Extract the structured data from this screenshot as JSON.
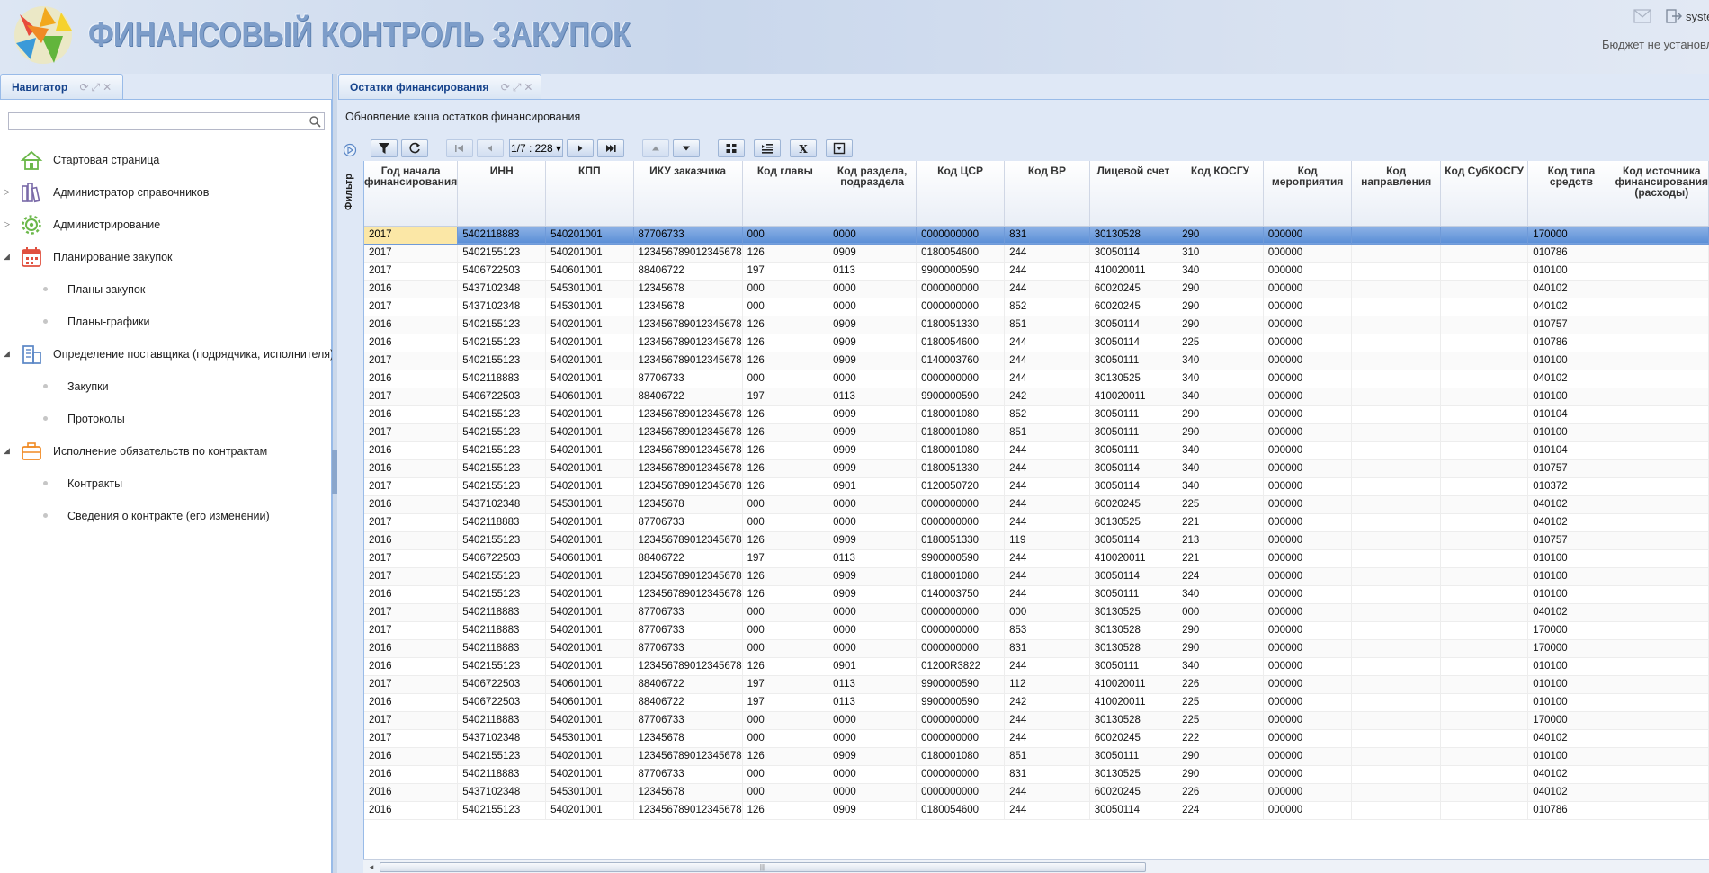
{
  "header": {
    "title": "ФИНАНСОВЫЙ КОНТРОЛЬ ЗАКУПОК",
    "user": "syste",
    "budget_status": "Бюджет не установл"
  },
  "navigator": {
    "tab_label": "Навигатор",
    "search_placeholder": "",
    "items": [
      {
        "label": "Стартовая страница",
        "icon": "house-icon",
        "arrow": ""
      },
      {
        "label": "Администратор справочников",
        "icon": "books-icon",
        "arrow": "▷"
      },
      {
        "label": "Администрирование",
        "icon": "gear-icon",
        "arrow": "▷"
      },
      {
        "label": "Планирование закупок",
        "icon": "calendar-icon",
        "arrow": "◢"
      },
      {
        "label": "Планы закупок",
        "sub": true
      },
      {
        "label": "Планы-графики",
        "sub": true
      },
      {
        "label": "Определение поставщика (подрядчика, исполнителя)",
        "icon": "building-icon",
        "arrow": "◢"
      },
      {
        "label": "Закупки",
        "sub": true
      },
      {
        "label": "Протоколы",
        "sub": true
      },
      {
        "label": "Исполнение обязательств по контрактам",
        "icon": "briefcase-icon",
        "arrow": "◢"
      },
      {
        "label": "Контракты",
        "sub": true
      },
      {
        "label": "Сведения о контракте (его изменении)",
        "sub": true
      }
    ]
  },
  "main": {
    "tab_label": "Остатки финансирования",
    "cache_update_label": "Обновление кэша остатков финансирования",
    "filter_label": "Фильтр",
    "pager": "1/7 : 228 ▾"
  },
  "grid": {
    "columns": [
      "Год начала финансирования",
      "ИНН",
      "КПП",
      "ИКУ заказчика",
      "Код главы",
      "Код раздела, подраздела",
      "Код ЦСР",
      "Код ВР",
      "Лицевой счет",
      "Код КОСГУ",
      "Код мероприятия",
      "Код направления",
      "Код СубКОСГУ",
      "Код типа средств",
      "Код источника финансирования (расходы)"
    ],
    "rows": [
      [
        "2017",
        "5402118883",
        "540201001",
        "87706733",
        "000",
        "0000",
        "0000000000",
        "831",
        "30130528",
        "290",
        "000000",
        "",
        "",
        "170000",
        ""
      ],
      [
        "2017",
        "5402155123",
        "540201001",
        "123456789012345678",
        "126",
        "0909",
        "0180054600",
        "244",
        "30050114",
        "310",
        "000000",
        "",
        "",
        "010786",
        ""
      ],
      [
        "2017",
        "5406722503",
        "540601001",
        "88406722",
        "197",
        "0113",
        "9900000590",
        "244",
        "410020011",
        "340",
        "000000",
        "",
        "",
        "010100",
        ""
      ],
      [
        "2016",
        "5437102348",
        "545301001",
        "12345678",
        "000",
        "0000",
        "0000000000",
        "244",
        "60020245",
        "290",
        "000000",
        "",
        "",
        "040102",
        ""
      ],
      [
        "2017",
        "5437102348",
        "545301001",
        "12345678",
        "000",
        "0000",
        "0000000000",
        "852",
        "60020245",
        "290",
        "000000",
        "",
        "",
        "040102",
        ""
      ],
      [
        "2016",
        "5402155123",
        "540201001",
        "123456789012345678",
        "126",
        "0909",
        "0180051330",
        "851",
        "30050114",
        "290",
        "000000",
        "",
        "",
        "010757",
        ""
      ],
      [
        "2016",
        "5402155123",
        "540201001",
        "123456789012345678",
        "126",
        "0909",
        "0180054600",
        "244",
        "30050114",
        "225",
        "000000",
        "",
        "",
        "010786",
        ""
      ],
      [
        "2017",
        "5402155123",
        "540201001",
        "123456789012345678",
        "126",
        "0909",
        "0140003760",
        "244",
        "30050111",
        "340",
        "000000",
        "",
        "",
        "010100",
        ""
      ],
      [
        "2016",
        "5402118883",
        "540201001",
        "87706733",
        "000",
        "0000",
        "0000000000",
        "244",
        "30130525",
        "340",
        "000000",
        "",
        "",
        "040102",
        ""
      ],
      [
        "2017",
        "5406722503",
        "540601001",
        "88406722",
        "197",
        "0113",
        "9900000590",
        "242",
        "410020011",
        "340",
        "000000",
        "",
        "",
        "010100",
        ""
      ],
      [
        "2016",
        "5402155123",
        "540201001",
        "123456789012345678",
        "126",
        "0909",
        "0180001080",
        "852",
        "30050111",
        "290",
        "000000",
        "",
        "",
        "010104",
        ""
      ],
      [
        "2017",
        "5402155123",
        "540201001",
        "123456789012345678",
        "126",
        "0909",
        "0180001080",
        "851",
        "30050111",
        "290",
        "000000",
        "",
        "",
        "010100",
        ""
      ],
      [
        "2016",
        "5402155123",
        "540201001",
        "123456789012345678",
        "126",
        "0909",
        "0180001080",
        "244",
        "30050111",
        "340",
        "000000",
        "",
        "",
        "010104",
        ""
      ],
      [
        "2016",
        "5402155123",
        "540201001",
        "123456789012345678",
        "126",
        "0909",
        "0180051330",
        "244",
        "30050114",
        "340",
        "000000",
        "",
        "",
        "010757",
        ""
      ],
      [
        "2017",
        "5402155123",
        "540201001",
        "123456789012345678",
        "126",
        "0901",
        "0120050720",
        "244",
        "30050114",
        "340",
        "000000",
        "",
        "",
        "010372",
        ""
      ],
      [
        "2016",
        "5437102348",
        "545301001",
        "12345678",
        "000",
        "0000",
        "0000000000",
        "244",
        "60020245",
        "225",
        "000000",
        "",
        "",
        "040102",
        ""
      ],
      [
        "2017",
        "5402118883",
        "540201001",
        "87706733",
        "000",
        "0000",
        "0000000000",
        "244",
        "30130525",
        "221",
        "000000",
        "",
        "",
        "040102",
        ""
      ],
      [
        "2016",
        "5402155123",
        "540201001",
        "123456789012345678",
        "126",
        "0909",
        "0180051330",
        "119",
        "30050114",
        "213",
        "000000",
        "",
        "",
        "010757",
        ""
      ],
      [
        "2017",
        "5406722503",
        "540601001",
        "88406722",
        "197",
        "0113",
        "9900000590",
        "244",
        "410020011",
        "221",
        "000000",
        "",
        "",
        "010100",
        ""
      ],
      [
        "2017",
        "5402155123",
        "540201001",
        "123456789012345678",
        "126",
        "0909",
        "0180001080",
        "244",
        "30050114",
        "224",
        "000000",
        "",
        "",
        "010100",
        ""
      ],
      [
        "2016",
        "5402155123",
        "540201001",
        "123456789012345678",
        "126",
        "0909",
        "0140003750",
        "244",
        "30050111",
        "340",
        "000000",
        "",
        "",
        "010100",
        ""
      ],
      [
        "2017",
        "5402118883",
        "540201001",
        "87706733",
        "000",
        "0000",
        "0000000000",
        "000",
        "30130525",
        "000",
        "000000",
        "",
        "",
        "040102",
        ""
      ],
      [
        "2017",
        "5402118883",
        "540201001",
        "87706733",
        "000",
        "0000",
        "0000000000",
        "853",
        "30130528",
        "290",
        "000000",
        "",
        "",
        "170000",
        ""
      ],
      [
        "2016",
        "5402118883",
        "540201001",
        "87706733",
        "000",
        "0000",
        "0000000000",
        "831",
        "30130528",
        "290",
        "000000",
        "",
        "",
        "170000",
        ""
      ],
      [
        "2016",
        "5402155123",
        "540201001",
        "123456789012345678",
        "126",
        "0901",
        "01200R3822",
        "244",
        "30050111",
        "340",
        "000000",
        "",
        "",
        "010100",
        ""
      ],
      [
        "2017",
        "5406722503",
        "540601001",
        "88406722",
        "197",
        "0113",
        "9900000590",
        "112",
        "410020011",
        "226",
        "000000",
        "",
        "",
        "010100",
        ""
      ],
      [
        "2016",
        "5406722503",
        "540601001",
        "88406722",
        "197",
        "0113",
        "9900000590",
        "242",
        "410020011",
        "225",
        "000000",
        "",
        "",
        "010100",
        ""
      ],
      [
        "2017",
        "5402118883",
        "540201001",
        "87706733",
        "000",
        "0000",
        "0000000000",
        "244",
        "30130528",
        "225",
        "000000",
        "",
        "",
        "170000",
        ""
      ],
      [
        "2017",
        "5437102348",
        "545301001",
        "12345678",
        "000",
        "0000",
        "0000000000",
        "244",
        "60020245",
        "222",
        "000000",
        "",
        "",
        "040102",
        ""
      ],
      [
        "2016",
        "5402155123",
        "540201001",
        "123456789012345678",
        "126",
        "0909",
        "0180001080",
        "851",
        "30050111",
        "290",
        "000000",
        "",
        "",
        "010100",
        ""
      ],
      [
        "2016",
        "5402118883",
        "540201001",
        "87706733",
        "000",
        "0000",
        "0000000000",
        "831",
        "30130525",
        "290",
        "000000",
        "",
        "",
        "040102",
        ""
      ],
      [
        "2016",
        "5437102348",
        "545301001",
        "12345678",
        "000",
        "0000",
        "0000000000",
        "244",
        "60020245",
        "226",
        "000000",
        "",
        "",
        "040102",
        ""
      ],
      [
        "2016",
        "5402155123",
        "540201001",
        "123456789012345678",
        "126",
        "0909",
        "0180054600",
        "244",
        "30050114",
        "224",
        "000000",
        "",
        "",
        "010786",
        ""
      ]
    ]
  },
  "scrollbar": {
    "thumb_grip": "|||"
  }
}
